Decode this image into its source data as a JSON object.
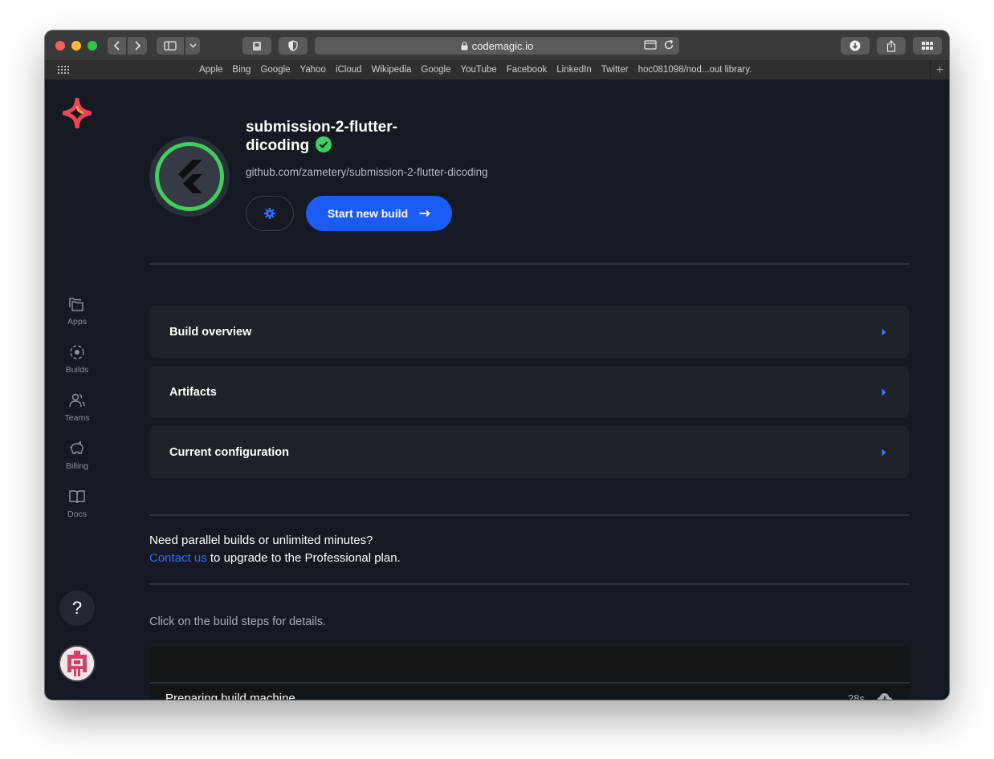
{
  "browser": {
    "url": "codemagic.io",
    "favorites": [
      "Apple",
      "Bing",
      "Google",
      "Yahoo",
      "iCloud",
      "Wikipedia",
      "Google",
      "YouTube",
      "Facebook",
      "LinkedIn",
      "Twitter",
      "hoc081098/nod...out library."
    ]
  },
  "sidebar": {
    "items": [
      {
        "label": "Apps",
        "icon": "folders-icon"
      },
      {
        "label": "Builds",
        "icon": "builds-icon"
      },
      {
        "label": "Teams",
        "icon": "team-icon"
      },
      {
        "label": "Billing",
        "icon": "piggy-bank-icon"
      },
      {
        "label": "Docs",
        "icon": "book-icon"
      }
    ],
    "help_label": "?"
  },
  "app": {
    "name_line1": "submission-2-flutter-",
    "name_line2": "dicoding",
    "repo": "github.com/zametery/submission-2-flutter-dicoding",
    "start_build_label": "Start new build"
  },
  "panels": [
    {
      "title": "Build overview"
    },
    {
      "title": "Artifacts"
    },
    {
      "title": "Current configuration"
    }
  ],
  "upgrade": {
    "line1": "Need parallel builds or unlimited minutes?",
    "link": "Contact us",
    "line2_rest": " to upgrade to the Professional plan."
  },
  "steps": {
    "hint": "Click on the build steps for details.",
    "items": [
      {
        "name": "Preparing build machine",
        "time": "28s"
      }
    ]
  },
  "colors": {
    "accent": "#1a5cf5",
    "success": "#3ecf5c",
    "background": "#151921",
    "panel": "#1e2229"
  }
}
